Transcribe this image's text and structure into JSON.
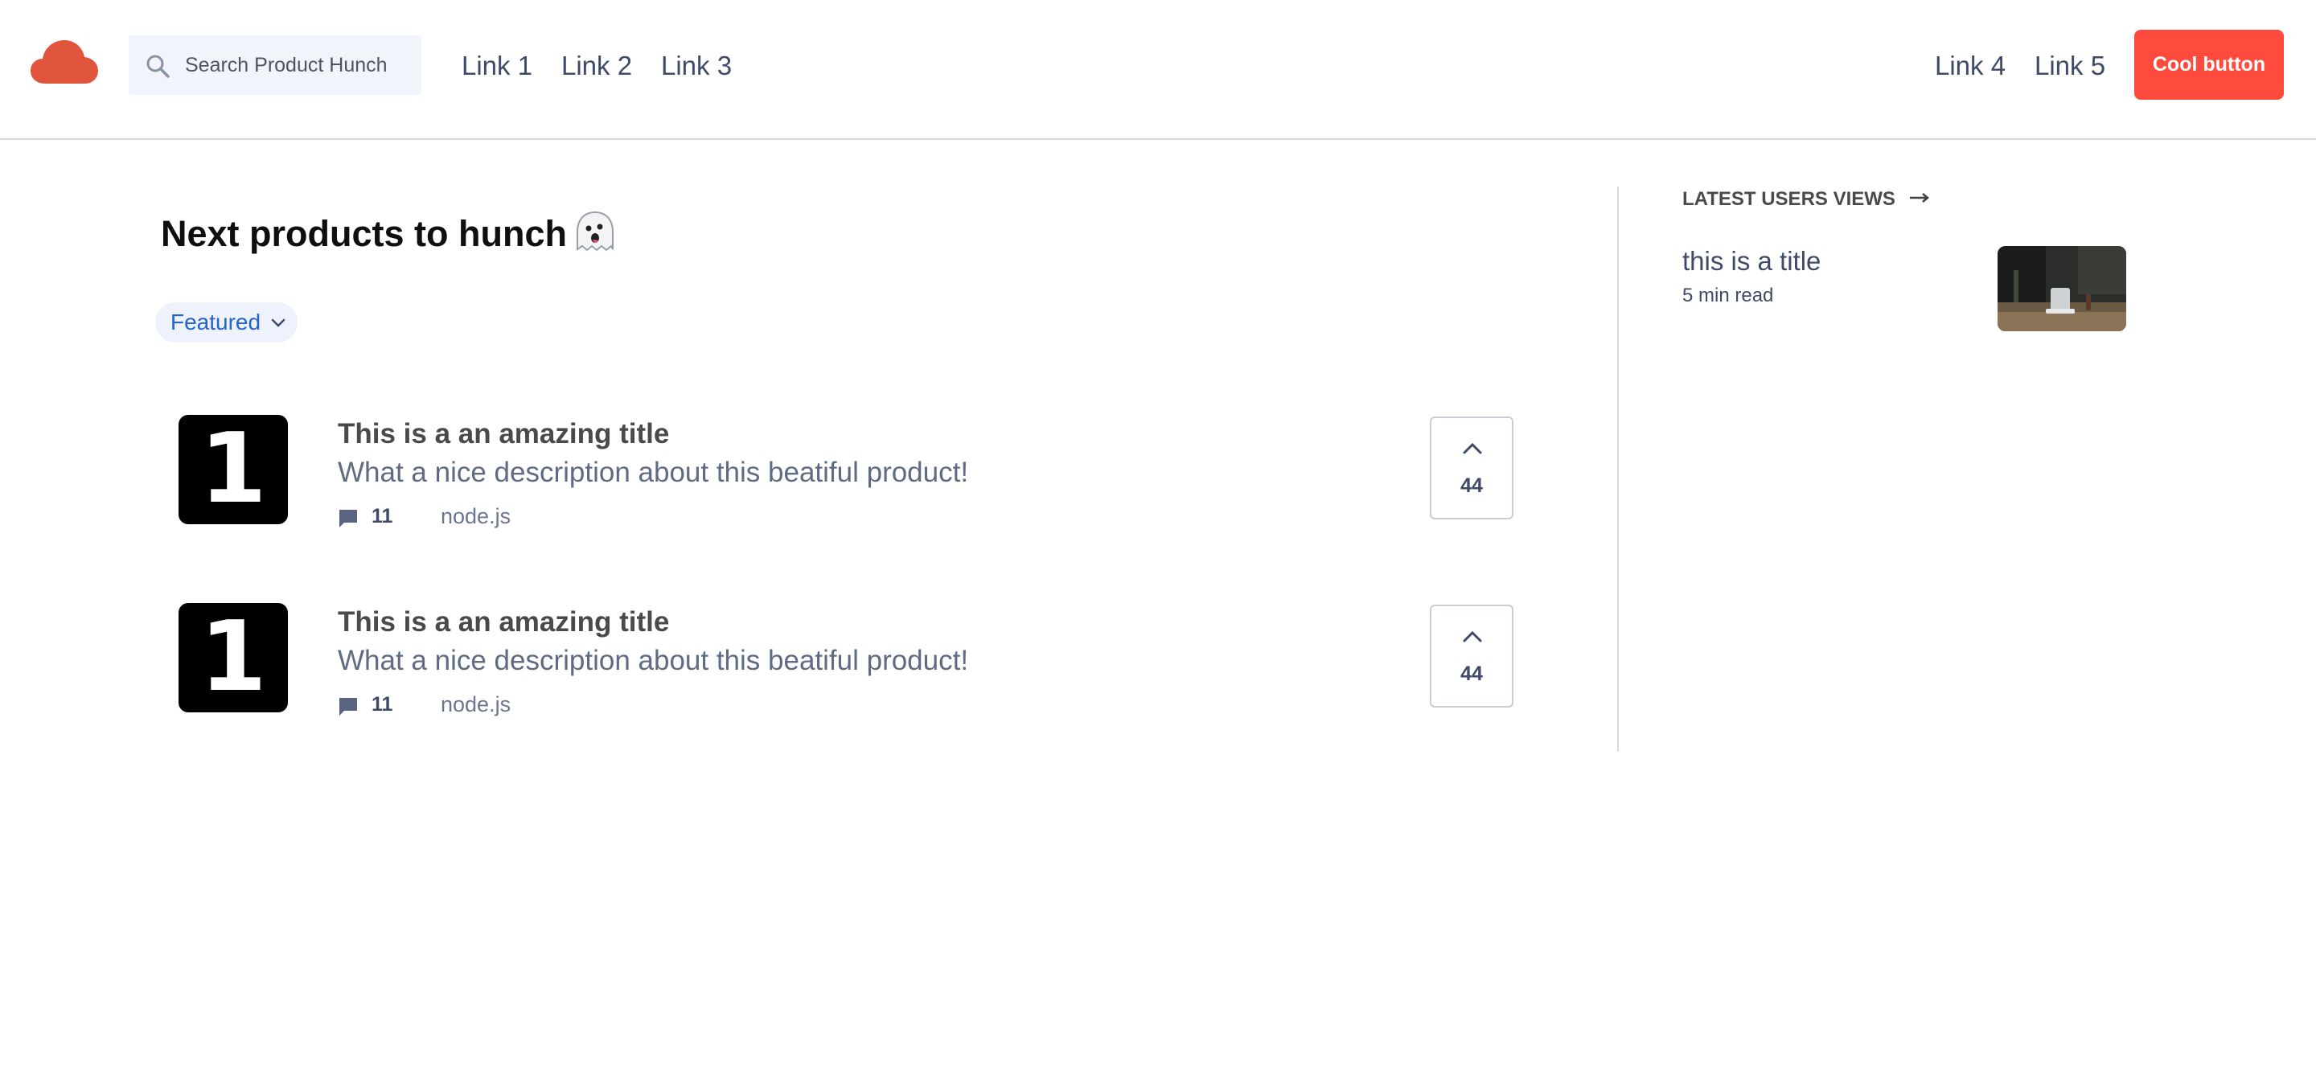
{
  "header": {
    "search_placeholder": "Search Product Hunch",
    "links_left": [
      "Link 1",
      "Link 2",
      "Link 3"
    ],
    "links_right": [
      "Link 4",
      "Link 5"
    ],
    "cta_label": "Cool button"
  },
  "main": {
    "title": "Next products to hunch",
    "filter_label": "Featured",
    "products": [
      {
        "thumb": "1",
        "title": "This is a an amazing title",
        "description": "What a nice description about this beatiful product!",
        "comments": "11",
        "tag": "node.js",
        "votes": "44"
      },
      {
        "thumb": "1",
        "title": "This is a an amazing title",
        "description": "What a nice description about this beatiful product!",
        "comments": "11",
        "tag": "node.js",
        "votes": "44"
      }
    ]
  },
  "sidebar": {
    "heading": "LATEST USERS VIEWS",
    "item": {
      "title": "this is a title",
      "meta": "5 min read"
    }
  },
  "colors": {
    "brand": "#e0553b",
    "cta": "#ff4b3e",
    "link": "#3f4a69",
    "filter_text": "#2563c9"
  }
}
